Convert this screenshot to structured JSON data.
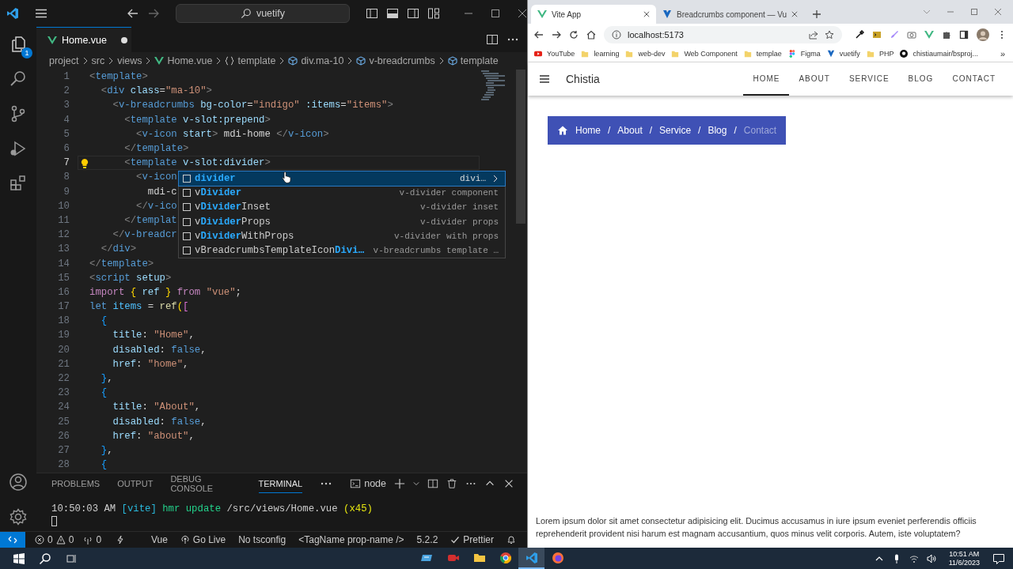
{
  "vscode": {
    "command_center": "vuetify",
    "explorer_badge": "1",
    "editor_tab": {
      "label": "Home.vue",
      "modified": true
    },
    "breadcrumbs": [
      {
        "label": "project",
        "kind": "folder"
      },
      {
        "label": "src",
        "kind": "folder"
      },
      {
        "label": "views",
        "kind": "folder"
      },
      {
        "label": "Home.vue",
        "kind": "vue"
      },
      {
        "label": "template",
        "kind": "braces"
      },
      {
        "label": "div.ma-10",
        "kind": "element"
      },
      {
        "label": "v-breadcrumbs",
        "kind": "element"
      },
      {
        "label": "template",
        "kind": "element"
      }
    ],
    "lines": [
      {
        "number": "1",
        "current": false,
        "tokens": [
          {
            "text": "<",
            "kind": "p"
          },
          {
            "text": "template",
            "kind": "tag"
          },
          {
            "text": ">",
            "kind": "p"
          }
        ]
      },
      {
        "number": "2",
        "current": false,
        "tokens": [
          {
            "text": "  <",
            "kind": "p"
          },
          {
            "text": "div",
            "kind": "tag"
          },
          {
            "text": " class",
            "kind": "attr"
          },
          {
            "text": "=",
            "kind": "txt"
          },
          {
            "text": "\"ma-10\"",
            "kind": "str"
          },
          {
            "text": ">",
            "kind": "p"
          }
        ]
      },
      {
        "number": "3",
        "current": false,
        "tokens": [
          {
            "text": "    <",
            "kind": "p"
          },
          {
            "text": "v-breadcrumbs",
            "kind": "tag"
          },
          {
            "text": " bg-color",
            "kind": "attr"
          },
          {
            "text": "=",
            "kind": "txt"
          },
          {
            "text": "\"indigo\"",
            "kind": "str"
          },
          {
            "text": " :items",
            "kind": "attr"
          },
          {
            "text": "=",
            "kind": "txt"
          },
          {
            "text": "\"items\"",
            "kind": "str"
          },
          {
            "text": ">",
            "kind": "p"
          }
        ]
      },
      {
        "number": "4",
        "current": false,
        "tokens": [
          {
            "text": "      <",
            "kind": "p"
          },
          {
            "text": "template",
            "kind": "tag"
          },
          {
            "text": " v-slot:prepend",
            "kind": "attr"
          },
          {
            "text": ">",
            "kind": "p"
          }
        ]
      },
      {
        "number": "5",
        "current": false,
        "tokens": [
          {
            "text": "        <",
            "kind": "p"
          },
          {
            "text": "v-icon",
            "kind": "tag"
          },
          {
            "text": " start",
            "kind": "attr"
          },
          {
            "text": ">",
            "kind": "p"
          },
          {
            "text": " mdi-home ",
            "kind": "txt"
          },
          {
            "text": "</",
            "kind": "p"
          },
          {
            "text": "v-icon",
            "kind": "tag"
          },
          {
            "text": ">",
            "kind": "p"
          }
        ]
      },
      {
        "number": "6",
        "current": false,
        "tokens": [
          {
            "text": "      </",
            "kind": "p"
          },
          {
            "text": "template",
            "kind": "tag"
          },
          {
            "text": ">",
            "kind": "p"
          }
        ]
      },
      {
        "number": "7",
        "current": true,
        "tokens": [
          {
            "text": "      <",
            "kind": "p"
          },
          {
            "text": "template",
            "kind": "tag"
          },
          {
            "text": " v-slot:divider",
            "kind": "attr"
          },
          {
            "text": ">",
            "kind": "p"
          }
        ]
      },
      {
        "number": "8",
        "current": false,
        "tokens": [
          {
            "text": "        <",
            "kind": "p"
          },
          {
            "text": "v-icon",
            "kind": "tag"
          }
        ]
      },
      {
        "number": "9",
        "current": false,
        "tokens": [
          {
            "text": "          mdi-c",
            "kind": "txt"
          }
        ]
      },
      {
        "number": "10",
        "current": false,
        "tokens": [
          {
            "text": "        </",
            "kind": "p"
          },
          {
            "text": "v-ico",
            "kind": "tag"
          }
        ]
      },
      {
        "number": "11",
        "current": false,
        "tokens": [
          {
            "text": "      </",
            "kind": "p"
          },
          {
            "text": "templat",
            "kind": "tag"
          }
        ]
      },
      {
        "number": "12",
        "current": false,
        "tokens": [
          {
            "text": "    </",
            "kind": "p"
          },
          {
            "text": "v-breadcr",
            "kind": "tag"
          }
        ]
      },
      {
        "number": "13",
        "current": false,
        "tokens": [
          {
            "text": "  </",
            "kind": "p"
          },
          {
            "text": "div",
            "kind": "tag"
          },
          {
            "text": ">",
            "kind": "p"
          }
        ]
      },
      {
        "number": "14",
        "current": false,
        "tokens": [
          {
            "text": "</",
            "kind": "p"
          },
          {
            "text": "template",
            "kind": "tag"
          },
          {
            "text": ">",
            "kind": "p"
          }
        ]
      },
      {
        "number": "15",
        "current": false,
        "tokens": [
          {
            "text": "<",
            "kind": "p"
          },
          {
            "text": "script",
            "kind": "tag"
          },
          {
            "text": " setup",
            "kind": "attr"
          },
          {
            "text": ">",
            "kind": "p"
          }
        ]
      },
      {
        "number": "16",
        "current": false,
        "tokens": [
          {
            "text": "import",
            "kind": "kw"
          },
          {
            "text": " {",
            "kind": "b1"
          },
          {
            "text": " ref ",
            "kind": "var"
          },
          {
            "text": "}",
            "kind": "b1"
          },
          {
            "text": " from ",
            "kind": "kw"
          },
          {
            "text": "\"vue\"",
            "kind": "str"
          },
          {
            "text": ";",
            "kind": "txt"
          }
        ]
      },
      {
        "number": "17",
        "current": false,
        "tokens": [
          {
            "text": "let",
            "kind": "key"
          },
          {
            "text": " items",
            "kind": "cvar"
          },
          {
            "text": " = ",
            "kind": "txt"
          },
          {
            "text": "ref",
            "kind": "fn"
          },
          {
            "text": "(",
            "kind": "b1"
          },
          {
            "text": "[",
            "kind": "b2"
          }
        ]
      },
      {
        "number": "18",
        "current": false,
        "tokens": [
          {
            "text": "  {",
            "kind": "b3"
          }
        ]
      },
      {
        "number": "19",
        "current": false,
        "tokens": [
          {
            "text": "    title",
            "kind": "var"
          },
          {
            "text": ": ",
            "kind": "txt"
          },
          {
            "text": "\"Home\"",
            "kind": "str"
          },
          {
            "text": ",",
            "kind": "txt"
          }
        ]
      },
      {
        "number": "20",
        "current": false,
        "tokens": [
          {
            "text": "    disabled",
            "kind": "var"
          },
          {
            "text": ": ",
            "kind": "txt"
          },
          {
            "text": "false",
            "kind": "key"
          },
          {
            "text": ",",
            "kind": "txt"
          }
        ]
      },
      {
        "number": "21",
        "current": false,
        "tokens": [
          {
            "text": "    href",
            "kind": "var"
          },
          {
            "text": ": ",
            "kind": "txt"
          },
          {
            "text": "\"home\"",
            "kind": "str"
          },
          {
            "text": ",",
            "kind": "txt"
          }
        ]
      },
      {
        "number": "22",
        "current": false,
        "tokens": [
          {
            "text": "  }",
            "kind": "b3"
          },
          {
            "text": ",",
            "kind": "txt"
          }
        ]
      },
      {
        "number": "23",
        "current": false,
        "tokens": [
          {
            "text": "  {",
            "kind": "b3"
          }
        ]
      },
      {
        "number": "24",
        "current": false,
        "tokens": [
          {
            "text": "    title",
            "kind": "var"
          },
          {
            "text": ": ",
            "kind": "txt"
          },
          {
            "text": "\"About\"",
            "kind": "str"
          },
          {
            "text": ",",
            "kind": "txt"
          }
        ]
      },
      {
        "number": "25",
        "current": false,
        "tokens": [
          {
            "text": "    disabled",
            "kind": "var"
          },
          {
            "text": ": ",
            "kind": "txt"
          },
          {
            "text": "false",
            "kind": "key"
          },
          {
            "text": ",",
            "kind": "txt"
          }
        ]
      },
      {
        "number": "26",
        "current": false,
        "tokens": [
          {
            "text": "    href",
            "kind": "var"
          },
          {
            "text": ": ",
            "kind": "txt"
          },
          {
            "text": "\"about\"",
            "kind": "str"
          },
          {
            "text": ",",
            "kind": "txt"
          }
        ]
      },
      {
        "number": "27",
        "current": false,
        "tokens": [
          {
            "text": "  }",
            "kind": "b3"
          },
          {
            "text": ",",
            "kind": "txt"
          }
        ]
      },
      {
        "number": "28",
        "current": false,
        "tokens": [
          {
            "text": "  {",
            "kind": "b3"
          }
        ]
      }
    ],
    "suggestions": [
      {
        "parts": [
          {
            "text": "divider",
            "match": true
          }
        ],
        "detail": "divi…",
        "selected": true
      },
      {
        "parts": [
          {
            "text": "v",
            "match": false
          },
          {
            "text": "Divider",
            "match": true
          }
        ],
        "detail": "v-divider component",
        "selected": false
      },
      {
        "parts": [
          {
            "text": "v",
            "match": false
          },
          {
            "text": "Divider",
            "match": true
          },
          {
            "text": "Inset",
            "match": false
          }
        ],
        "detail": "v-divider inset",
        "selected": false
      },
      {
        "parts": [
          {
            "text": "v",
            "match": false
          },
          {
            "text": "Divider",
            "match": true
          },
          {
            "text": "Props",
            "match": false
          }
        ],
        "detail": "v-divider props",
        "selected": false
      },
      {
        "parts": [
          {
            "text": "v",
            "match": false
          },
          {
            "text": "Divider",
            "match": true
          },
          {
            "text": "WithProps",
            "match": false
          }
        ],
        "detail": "v-divider with props",
        "selected": false
      },
      {
        "parts": [
          {
            "text": "vBreadcrumbsTemplateIcon",
            "match": false
          },
          {
            "text": "Divi…",
            "match": true
          }
        ],
        "detail": "v-breadcrumbs template …",
        "selected": false
      }
    ],
    "panel_tabs": [
      {
        "label": "PROBLEMS",
        "selected": false
      },
      {
        "label": "OUTPUT",
        "selected": false
      },
      {
        "label": "DEBUG CONSOLE",
        "selected": false
      },
      {
        "label": "TERMINAL",
        "selected": true
      }
    ],
    "terminal_name": "node",
    "terminal_line": [
      {
        "text": "10:50:03 AM ",
        "kind": "plain"
      },
      {
        "text": "[vite]",
        "kind": "cyan"
      },
      {
        "text": " hmr update",
        "kind": "green"
      },
      {
        "text": " /src/views/Home.vue ",
        "kind": "plain"
      },
      {
        "text": "(x45)",
        "kind": "yellow"
      }
    ],
    "status": {
      "errors": "0",
      "warnings": "0",
      "ports": "0",
      "items": [
        {
          "text": "Vue",
          "kind": "plain"
        },
        {
          "text": "Go Live",
          "kind": "golive"
        },
        {
          "text": "No tsconfig",
          "kind": "plain"
        },
        {
          "text": "<TagName prop-name />",
          "kind": "plain"
        },
        {
          "text": "5.2.2",
          "kind": "plain"
        },
        {
          "text": "Prettier",
          "kind": "check"
        }
      ]
    }
  },
  "browser": {
    "tabs": [
      {
        "title": "Vite App",
        "kind": "vite",
        "selected": true
      },
      {
        "title": "Breadcrumbs component — Vu",
        "kind": "vuetify",
        "selected": false
      }
    ],
    "address": "localhost:5173",
    "bookmarks": [
      {
        "label": "YouTube",
        "kind": "youtube"
      },
      {
        "label": "learning",
        "kind": "folder"
      },
      {
        "label": "web-dev",
        "kind": "folder"
      },
      {
        "label": "Web Component",
        "kind": "folder"
      },
      {
        "label": "templae",
        "kind": "folder"
      },
      {
        "label": "Figma",
        "kind": "figma"
      },
      {
        "label": "vuetify",
        "kind": "vuetify"
      },
      {
        "label": "PHP",
        "kind": "folder"
      },
      {
        "label": "chistiaumair/bsproj...",
        "kind": "github"
      }
    ],
    "bookmarks_more": "»",
    "page": {
      "brand": "Chistia",
      "nav": [
        {
          "label": "HOME",
          "selected": true
        },
        {
          "label": "ABOUT",
          "selected": false
        },
        {
          "label": "SERVICE",
          "selected": false
        },
        {
          "label": "BLOG",
          "selected": false
        },
        {
          "label": "CONTACT",
          "selected": false
        }
      ],
      "breadcrumbs": [
        {
          "kind": "item",
          "title": "Home",
          "disabled": false
        },
        {
          "kind": "divider",
          "title": "/"
        },
        {
          "kind": "item",
          "title": "About",
          "disabled": false
        },
        {
          "kind": "divider",
          "title": "/"
        },
        {
          "kind": "item",
          "title": "Service",
          "disabled": false
        },
        {
          "kind": "divider",
          "title": "/"
        },
        {
          "kind": "item",
          "title": "Blog",
          "disabled": false
        },
        {
          "kind": "divider",
          "title": "/"
        },
        {
          "kind": "item",
          "title": "Contact",
          "disabled": true
        }
      ],
      "text": "Lorem ipsum dolor sit amet consectetur adipisicing elit. Ducimus accusamus in iure ipsum eveniet perferendis officiis reprehenderit provident nisi harum est magnam accusantium, quos minus velit corporis. Autem, iste voluptatem?"
    }
  },
  "taskbar": {
    "apps": [
      {
        "kind": "board",
        "active": false
      },
      {
        "kind": "recorder",
        "active": false
      },
      {
        "kind": "folder",
        "active": false
      },
      {
        "kind": "chrome",
        "active": false
      },
      {
        "kind": "vscode",
        "active": true
      },
      {
        "kind": "firefox",
        "active": false
      }
    ],
    "time": "10:51 AM",
    "date": "11/6/2023"
  }
}
